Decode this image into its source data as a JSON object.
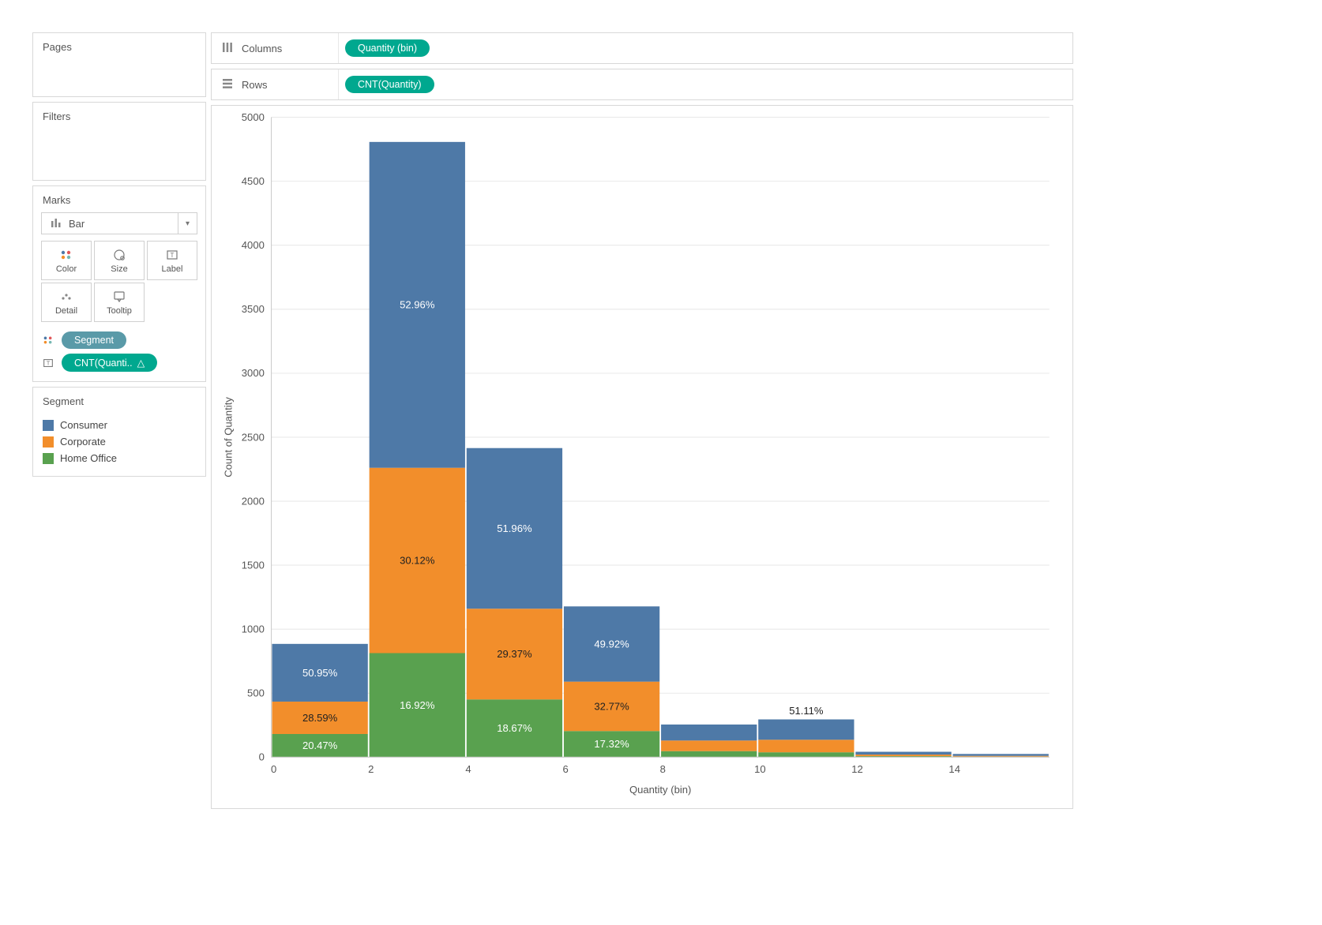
{
  "shelves": {
    "columns_label": "Columns",
    "rows_label": "Rows",
    "columns_pill": "Quantity (bin)",
    "rows_pill": "CNT(Quantity)"
  },
  "panels": {
    "pages_title": "Pages",
    "filters_title": "Filters",
    "marks_title": "Marks",
    "mark_type": "Bar",
    "mark_cells": {
      "color": "Color",
      "size": "Size",
      "label": "Label",
      "detail": "Detail",
      "tooltip": "Tooltip"
    },
    "mark_pill_segment": "Segment",
    "mark_pill_cnt": "CNT(Quanti..",
    "legend_title": "Segment",
    "legend_items": [
      {
        "name": "Consumer",
        "color": "#4e79a7"
      },
      {
        "name": "Corporate",
        "color": "#f28e2b"
      },
      {
        "name": "Home Office",
        "color": "#59a14f"
      }
    ]
  },
  "chart_data": {
    "type": "bar",
    "stacked": true,
    "xlabel": "Quantity (bin)",
    "ylabel": "Count of Quantity",
    "ylim": [
      0,
      5000
    ],
    "yticks": [
      0,
      500,
      1000,
      1500,
      2000,
      2500,
      3000,
      3500,
      4000,
      4500,
      5000
    ],
    "categories": [
      0,
      2,
      4,
      6,
      8,
      10,
      12,
      14
    ],
    "series": [
      {
        "name": "Home Office",
        "color": "#59a14f",
        "values": [
          181,
          813,
          451,
          204,
          47,
          38,
          8,
          4
        ]
      },
      {
        "name": "Corporate",
        "color": "#f28e2b",
        "values": [
          253,
          1448,
          709,
          386,
          83,
          98,
          12,
          6
        ]
      },
      {
        "name": "Consumer",
        "color": "#4e79a7",
        "values": [
          451,
          2546,
          1255,
          588,
          125,
          159,
          22,
          15
        ]
      }
    ],
    "labels": [
      {
        "bin": 0,
        "seg": "Home Office",
        "text": "20.47%",
        "dark": false
      },
      {
        "bin": 0,
        "seg": "Corporate",
        "text": "28.59%",
        "dark": true
      },
      {
        "bin": 0,
        "seg": "Consumer",
        "text": "50.95%",
        "dark": false
      },
      {
        "bin": 2,
        "seg": "Home Office",
        "text": "16.92%",
        "dark": false
      },
      {
        "bin": 2,
        "seg": "Corporate",
        "text": "30.12%",
        "dark": true
      },
      {
        "bin": 2,
        "seg": "Consumer",
        "text": "52.96%",
        "dark": false
      },
      {
        "bin": 4,
        "seg": "Home Office",
        "text": "18.67%",
        "dark": false
      },
      {
        "bin": 4,
        "seg": "Corporate",
        "text": "29.37%",
        "dark": true
      },
      {
        "bin": 4,
        "seg": "Consumer",
        "text": "51.96%",
        "dark": false
      },
      {
        "bin": 6,
        "seg": "Home Office",
        "text": "17.32%",
        "dark": false
      },
      {
        "bin": 6,
        "seg": "Corporate",
        "text": "32.77%",
        "dark": true
      },
      {
        "bin": 6,
        "seg": "Consumer",
        "text": "49.92%",
        "dark": false
      },
      {
        "bin": 10,
        "seg": "Consumer",
        "text": "51.11%",
        "dark": true,
        "above": true
      }
    ]
  }
}
